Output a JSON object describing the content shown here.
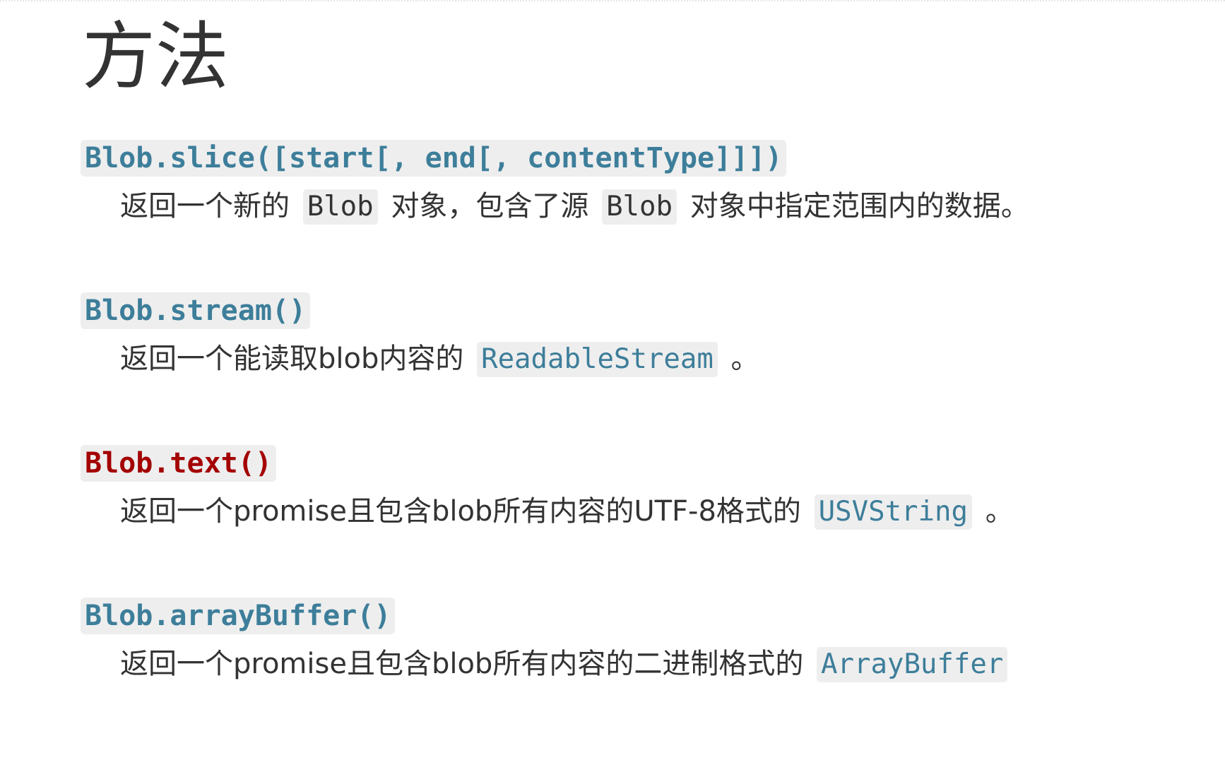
{
  "page": {
    "title": "方法"
  },
  "methods": [
    {
      "name": "Blob.slice([start[, end[, contentType]]])",
      "description": {
        "part1": "返回一个新的",
        "code1": "Blob",
        "part2": "对象，包含了源",
        "code2": "Blob",
        "part3": "对象中指定范围内的数据。"
      }
    },
    {
      "name": "Blob.stream()",
      "description": {
        "part1": "返回一个能读取blob内容的",
        "code1": "ReadableStream",
        "part2": "。"
      }
    },
    {
      "name": "Blob.text()",
      "description": {
        "part1": "返回一个promise且包含blob所有内容的UTF-8格式的",
        "code1": "USVString",
        "part2": "。"
      }
    },
    {
      "name": "Blob.arrayBuffer()",
      "description": {
        "part1": "返回一个promise且包含blob所有内容的二进制格式的",
        "code1": "ArrayBuffer"
      }
    }
  ],
  "colors": {
    "method_link": "#3d7e9a",
    "method_missing": "#a40000",
    "code_background": "#eeeeee",
    "text": "#333333"
  }
}
